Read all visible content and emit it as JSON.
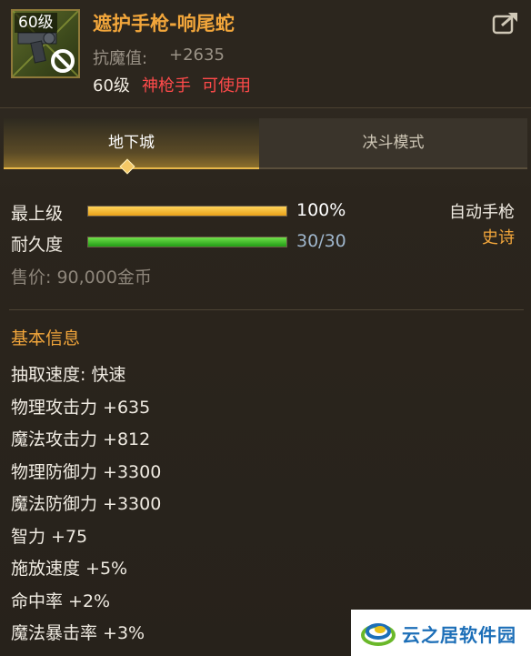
{
  "item": {
    "level_tag": "60级",
    "name": "遮护手枪-响尾蛇",
    "resist_label": "抗魔值:",
    "resist_value": "+2635",
    "req_level": "60级",
    "req_class": "神枪手",
    "req_usable": "可使用"
  },
  "tabs": [
    {
      "label": "地下城",
      "active": true
    },
    {
      "label": "决斗模式",
      "active": false
    }
  ],
  "stats": {
    "upgrade_label": "最上级",
    "upgrade_percent": "100%",
    "upgrade_fraction": 1.0,
    "durability_label": "耐久度",
    "durability_value": "30/30",
    "durability_fraction": 1.0,
    "weapon_type": "自动手枪",
    "rarity": "史诗",
    "price": "售价: 90,000金币"
  },
  "basic_info": {
    "title": "基本信息",
    "attributes": [
      "抽取速度: 快速",
      "物理攻击力 +635",
      "魔法攻击力 +812",
      "物理防御力 +3300",
      "魔法防御力 +3300",
      "智力 +75",
      "施放速度 +5%",
      "命中率 +2%",
      "魔法暴击率 +3%"
    ]
  },
  "watermark": {
    "text": "云之居软件园"
  },
  "icons": {
    "share": "share-icon",
    "item": "pistol-icon",
    "no_use": "prohibited-icon"
  },
  "colors": {
    "rarity_orange": "#f2a63b",
    "restriction_red": "#ff4a4a",
    "upgrade_bar": "#e8a11a",
    "durability_bar": "#229a16"
  }
}
